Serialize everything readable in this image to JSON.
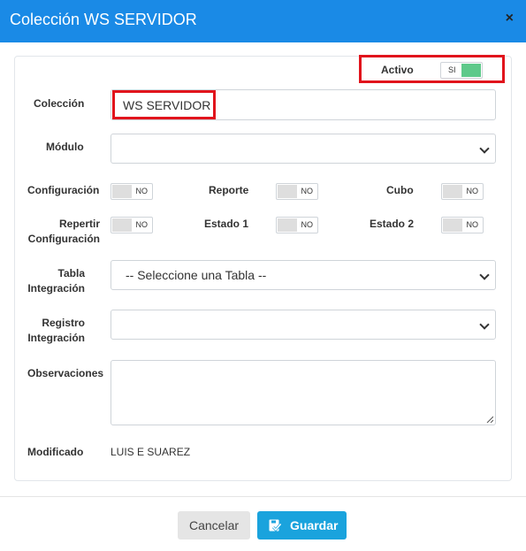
{
  "header": {
    "title": "Colección WS SERVIDOR",
    "close_label": "×"
  },
  "form": {
    "activo": {
      "label": "Activo",
      "toggle_text": "SI",
      "on": true
    },
    "coleccion": {
      "label": "Colección",
      "value": "WS SERVIDOR"
    },
    "modulo": {
      "label": "Módulo",
      "value": ""
    },
    "configuracion": {
      "label": "Configuración",
      "toggle_text": "NO"
    },
    "reporte": {
      "label": "Reporte",
      "toggle_text": "NO"
    },
    "cubo": {
      "label": "Cubo",
      "toggle_text": "NO"
    },
    "repertir_configuracion": {
      "label_line1": "Repertir",
      "label_line2": "Configuración",
      "toggle_text": "NO"
    },
    "estado1": {
      "label": "Estado 1",
      "toggle_text": "NO"
    },
    "estado2": {
      "label": "Estado 2",
      "toggle_text": "NO"
    },
    "tabla_integracion": {
      "label_line1": "Tabla",
      "label_line2": "Integración",
      "value": "-- Seleccione una Tabla --"
    },
    "registro_integracion": {
      "label_line1": "Registro",
      "label_line2": "Integración",
      "value": ""
    },
    "observaciones": {
      "label": "Observaciones",
      "value": ""
    },
    "modificado": {
      "label": "Modificado",
      "value": "LUIS E SUAREZ"
    }
  },
  "footer": {
    "cancel_label": "Cancelar",
    "save_label": "Guardar"
  },
  "colors": {
    "header": "#1a8ae6",
    "toggle_on": "#5ec98a",
    "highlight": "#e1141c",
    "save_button": "#1aa3dd"
  }
}
